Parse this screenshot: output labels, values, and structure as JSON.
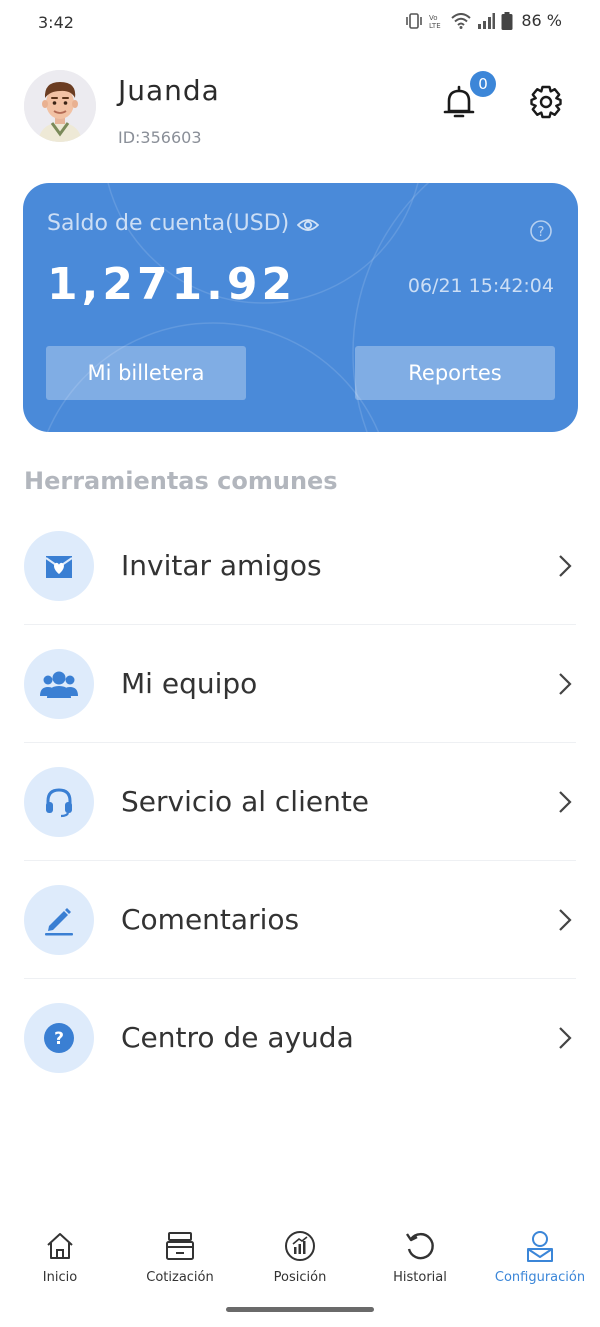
{
  "status_bar": {
    "time": "3:42",
    "battery": "86 %"
  },
  "profile": {
    "name": "Juanda",
    "id_text": "ID:356603",
    "notification_count": "0"
  },
  "balance_card": {
    "label": "Saldo de cuenta(USD)",
    "amount": "1,271.92",
    "timestamp": "06/21 15:42:04",
    "wallet_button": "Mi billetera",
    "reports_button": "Reportes",
    "color": "#4a8ad9"
  },
  "tools": {
    "title": "Herramientas comunes",
    "items": [
      {
        "label": "Invitar amigos",
        "icon": "invite-icon"
      },
      {
        "label": "Mi equipo",
        "icon": "team-icon"
      },
      {
        "label": "Servicio al cliente",
        "icon": "headset-icon"
      },
      {
        "label": "Comentarios",
        "icon": "edit-icon"
      },
      {
        "label": "Centro de ayuda",
        "icon": "question-icon"
      }
    ]
  },
  "tabbar": {
    "active": "Configuración",
    "accent": "#3b86d8",
    "tabs": [
      {
        "label": "Inicio",
        "icon": "home-icon"
      },
      {
        "label": "Cotización",
        "icon": "quote-icon"
      },
      {
        "label": "Posición",
        "icon": "position-icon"
      },
      {
        "label": "Historial",
        "icon": "history-icon"
      },
      {
        "label": "Configuración",
        "icon": "profile-icon"
      }
    ]
  }
}
